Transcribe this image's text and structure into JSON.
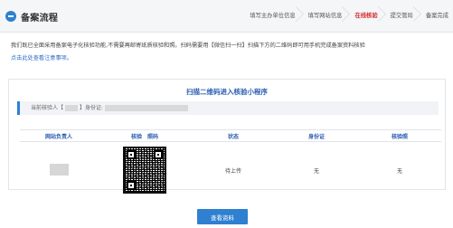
{
  "header": {
    "title": "备案流程",
    "steps": [
      {
        "label": "填写主办单位信息",
        "active": false
      },
      {
        "label": "填写网站信息",
        "active": false
      },
      {
        "label": "在线核验",
        "active": true
      },
      {
        "label": "提交管局",
        "active": false
      },
      {
        "label": "备案完成",
        "active": false
      }
    ]
  },
  "notice": {
    "text": "我们既已全面采用备案电子化核验功能,不需要再邮寄纸质核验和照。扫码需要用【微信扫一扫】扫描下方的二维码即可用手机完成备案资料核验",
    "link": "点击此处查看注意事项。"
  },
  "panel": {
    "title": "扫描二维码进入核验小程序",
    "info_prefix": "当前核验人【",
    "info_mid": "】身份证:",
    "columns": [
      "网站负责人",
      "核验　照码",
      "状态",
      "身份证",
      "核验照"
    ],
    "row": {
      "status": "待上传",
      "id_card": "无",
      "photo": "无"
    }
  },
  "footer": {
    "button": "查看资料"
  },
  "colors": {
    "accent": "#2f80d1",
    "active_step": "#d32f2f",
    "panel_title": "#2a5db0"
  }
}
